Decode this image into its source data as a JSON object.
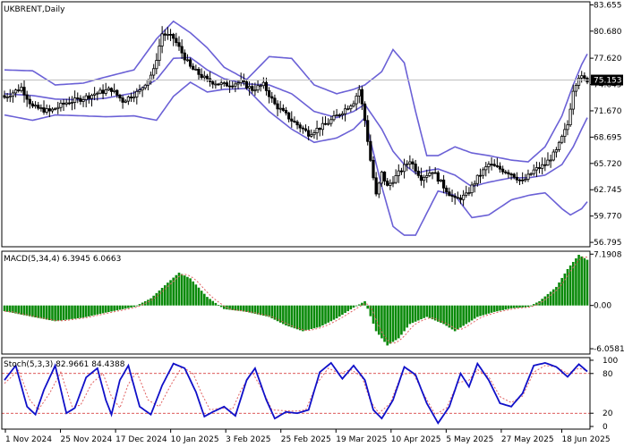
{
  "chart_data": [
    {
      "type": "candlestick",
      "title": "UKBRENT,Daily",
      "last_price_label": "75.153",
      "y_ticks": [
        "83.655",
        "80.680",
        "77.620",
        "74.645",
        "71.670",
        "68.695",
        "65.720",
        "62.745",
        "59.770",
        "56.795"
      ],
      "y_tick_values": [
        83.655,
        80.68,
        77.62,
        74.645,
        71.67,
        68.695,
        65.72,
        62.745,
        59.77,
        56.795
      ],
      "ylim": [
        56.3,
        84.0
      ],
      "x_labels": [
        "1 Nov 2024",
        "25 Nov 2024",
        "17 Dec 2024",
        "10 Jan 2025",
        "3 Feb 2025",
        "25 Feb 2025",
        "19 Mar 2025",
        "10 Apr 2025",
        "5 May 2025",
        "27 May 2025",
        "18 Jun 2025"
      ],
      "colors": {
        "up": "#000000",
        "down": "#000000",
        "bollinger": "#6b61d6",
        "last_line": "#c0c0c0"
      },
      "close_keypoints": [
        [
          0,
          73.2
        ],
        [
          6,
          74.3
        ],
        [
          10,
          72.1
        ],
        [
          16,
          71.6
        ],
        [
          22,
          72.6
        ],
        [
          28,
          73.1
        ],
        [
          32,
          73.6
        ],
        [
          38,
          74.1
        ],
        [
          42,
          72.8
        ],
        [
          48,
          73.9
        ],
        [
          53,
          76.2
        ],
        [
          56,
          80.4
        ],
        [
          60,
          79.9
        ],
        [
          66,
          76.6
        ],
        [
          72,
          75.1
        ],
        [
          78,
          74.6
        ],
        [
          84,
          74.9
        ],
        [
          88,
          74.1
        ],
        [
          92,
          74.6
        ],
        [
          96,
          72.4
        ],
        [
          102,
          70.6
        ],
        [
          108,
          69.1
        ],
        [
          114,
          70.1
        ],
        [
          120,
          71.6
        ],
        [
          124,
          72.7
        ],
        [
          126,
          74.1
        ],
        [
          128,
          70.6
        ],
        [
          130,
          66.1
        ],
        [
          132,
          62.1
        ],
        [
          134,
          64.6
        ],
        [
          136,
          63.1
        ],
        [
          140,
          64.6
        ],
        [
          144,
          66.1
        ],
        [
          148,
          64.1
        ],
        [
          152,
          64.9
        ],
        [
          156,
          63.1
        ],
        [
          160,
          61.6
        ],
        [
          164,
          62.1
        ],
        [
          168,
          64.1
        ],
        [
          172,
          65.6
        ],
        [
          176,
          65.1
        ],
        [
          180,
          64.6
        ],
        [
          184,
          63.6
        ],
        [
          188,
          64.9
        ],
        [
          192,
          65.6
        ],
        [
          196,
          67.1
        ],
        [
          200,
          70.1
        ],
        [
          202,
          74.1
        ],
        [
          204,
          75.6
        ],
        [
          206,
          75.2
        ],
        [
          207,
          75.15
        ]
      ],
      "bollinger_upper_keypoints": [
        [
          0,
          76.3
        ],
        [
          10,
          76.2
        ],
        [
          18,
          74.6
        ],
        [
          28,
          74.8
        ],
        [
          36,
          75.5
        ],
        [
          46,
          76.3
        ],
        [
          54,
          79.8
        ],
        [
          60,
          81.8
        ],
        [
          66,
          80.5
        ],
        [
          72,
          78.8
        ],
        [
          78,
          76.6
        ],
        [
          86,
          75.2
        ],
        [
          94,
          77.8
        ],
        [
          102,
          77.6
        ],
        [
          110,
          74.6
        ],
        [
          118,
          73.6
        ],
        [
          124,
          74.1
        ],
        [
          128,
          74.6
        ],
        [
          134,
          76.1
        ],
        [
          138,
          78.6
        ],
        [
          142,
          77.1
        ],
        [
          146,
          71.6
        ],
        [
          150,
          66.6
        ],
        [
          154,
          66.6
        ],
        [
          160,
          67.6
        ],
        [
          166,
          66.9
        ],
        [
          172,
          66.6
        ],
        [
          180,
          66.1
        ],
        [
          186,
          65.9
        ],
        [
          192,
          67.6
        ],
        [
          198,
          71.1
        ],
        [
          202,
          74.6
        ],
        [
          205,
          76.9
        ],
        [
          207,
          78.1
        ]
      ],
      "bollinger_middle_keypoints": [
        [
          0,
          73.6
        ],
        [
          10,
          73.4
        ],
        [
          18,
          73.0
        ],
        [
          28,
          72.9
        ],
        [
          36,
          73.1
        ],
        [
          46,
          73.7
        ],
        [
          54,
          75.2
        ],
        [
          60,
          77.6
        ],
        [
          66,
          77.7
        ],
        [
          72,
          76.3
        ],
        [
          78,
          75.3
        ],
        [
          86,
          74.7
        ],
        [
          94,
          74.6
        ],
        [
          102,
          73.6
        ],
        [
          110,
          71.6
        ],
        [
          118,
          70.9
        ],
        [
          124,
          71.6
        ],
        [
          128,
          72.4
        ],
        [
          134,
          69.6
        ],
        [
          138,
          67.1
        ],
        [
          142,
          65.6
        ],
        [
          146,
          64.6
        ],
        [
          150,
          64.9
        ],
        [
          154,
          65.1
        ],
        [
          160,
          64.4
        ],
        [
          166,
          63.1
        ],
        [
          172,
          63.6
        ],
        [
          180,
          64.1
        ],
        [
          186,
          64.1
        ],
        [
          192,
          64.4
        ],
        [
          198,
          65.6
        ],
        [
          202,
          67.6
        ],
        [
          205,
          69.6
        ],
        [
          207,
          70.9
        ]
      ],
      "bollinger_lower_keypoints": [
        [
          0,
          71.2
        ],
        [
          10,
          70.6
        ],
        [
          18,
          71.2
        ],
        [
          28,
          71.1
        ],
        [
          36,
          71.0
        ],
        [
          46,
          71.1
        ],
        [
          54,
          70.6
        ],
        [
          60,
          73.3
        ],
        [
          66,
          74.9
        ],
        [
          72,
          73.8
        ],
        [
          78,
          74.1
        ],
        [
          86,
          74.2
        ],
        [
          94,
          71.6
        ],
        [
          102,
          69.6
        ],
        [
          110,
          68.1
        ],
        [
          118,
          68.6
        ],
        [
          124,
          69.6
        ],
        [
          128,
          70.9
        ],
        [
          134,
          63.1
        ],
        [
          138,
          58.6
        ],
        [
          142,
          57.6
        ],
        [
          146,
          57.6
        ],
        [
          150,
          60.1
        ],
        [
          154,
          62.6
        ],
        [
          160,
          62.1
        ],
        [
          166,
          59.6
        ],
        [
          172,
          59.9
        ],
        [
          180,
          61.6
        ],
        [
          186,
          62.1
        ],
        [
          192,
          62.4
        ],
        [
          198,
          60.6
        ],
        [
          201,
          59.9
        ],
        [
          205,
          60.6
        ],
        [
          207,
          61.4
        ]
      ]
    },
    {
      "type": "bar",
      "title": "MACD(5,34,4) 6.3945 6.0663",
      "indicator": "MACD",
      "params": [
        5,
        34,
        4
      ],
      "current_macd": 6.3945,
      "current_signal": 6.0663,
      "y_ticks": [
        "7.1908",
        "0.00",
        "-6.0581"
      ],
      "y_tick_values": [
        7.1908,
        0,
        -6.0581
      ],
      "ylim": [
        -6.8,
        7.6
      ],
      "colors": {
        "histogram": "#0a8a0a",
        "signal": "#e06060"
      },
      "macd_keypoints": [
        [
          0,
          -0.8
        ],
        [
          10,
          -1.6
        ],
        [
          18,
          -2.2
        ],
        [
          28,
          -1.7
        ],
        [
          36,
          -1.0
        ],
        [
          46,
          -0.2
        ],
        [
          52,
          1.0
        ],
        [
          58,
          3.2
        ],
        [
          62,
          4.6
        ],
        [
          66,
          3.8
        ],
        [
          72,
          1.2
        ],
        [
          78,
          -0.5
        ],
        [
          86,
          -0.9
        ],
        [
          94,
          -1.6
        ],
        [
          100,
          -2.8
        ],
        [
          106,
          -3.6
        ],
        [
          112,
          -3.0
        ],
        [
          118,
          -1.8
        ],
        [
          124,
          -0.3
        ],
        [
          128,
          0.6
        ],
        [
          132,
          -3.6
        ],
        [
          136,
          -5.6
        ],
        [
          140,
          -4.6
        ],
        [
          144,
          -2.6
        ],
        [
          150,
          -1.6
        ],
        [
          156,
          -2.6
        ],
        [
          160,
          -3.6
        ],
        [
          164,
          -2.6
        ],
        [
          168,
          -1.6
        ],
        [
          174,
          -0.9
        ],
        [
          180,
          -0.4
        ],
        [
          186,
          -0.2
        ],
        [
          190,
          0.6
        ],
        [
          196,
          2.6
        ],
        [
          200,
          5.1
        ],
        [
          204,
          7.1
        ],
        [
          207,
          6.4
        ]
      ]
    },
    {
      "type": "line",
      "title": "Stoch(5,3,3) 82.9661 84.4388",
      "indicator": "Stochastic",
      "params": [
        5,
        3,
        3
      ],
      "current_k": 82.9661,
      "current_d": 84.4388,
      "y_ticks": [
        "100",
        "80",
        "20",
        "0"
      ],
      "y_tick_values": [
        100,
        80,
        20,
        0
      ],
      "levels": [
        80,
        20
      ],
      "ylim": [
        -4,
        104
      ],
      "colors": {
        "k_line": "#1010c8",
        "d_line": "#e06060",
        "levels": "#d02020"
      },
      "k_keypoints": [
        [
          0,
          70
        ],
        [
          4,
          92
        ],
        [
          8,
          30
        ],
        [
          11,
          18
        ],
        [
          14,
          55
        ],
        [
          18,
          92
        ],
        [
          22,
          20
        ],
        [
          25,
          28
        ],
        [
          29,
          74
        ],
        [
          33,
          88
        ],
        [
          36,
          40
        ],
        [
          38,
          18
        ],
        [
          41,
          70
        ],
        [
          44,
          92
        ],
        [
          48,
          30
        ],
        [
          52,
          18
        ],
        [
          56,
          62
        ],
        [
          60,
          95
        ],
        [
          64,
          88
        ],
        [
          68,
          52
        ],
        [
          71,
          15
        ],
        [
          74,
          22
        ],
        [
          78,
          30
        ],
        [
          82,
          16
        ],
        [
          86,
          70
        ],
        [
          89,
          88
        ],
        [
          93,
          40
        ],
        [
          96,
          12
        ],
        [
          100,
          22
        ],
        [
          104,
          20
        ],
        [
          108,
          25
        ],
        [
          112,
          82
        ],
        [
          116,
          96
        ],
        [
          120,
          72
        ],
        [
          124,
          92
        ],
        [
          128,
          70
        ],
        [
          131,
          25
        ],
        [
          134,
          12
        ],
        [
          138,
          40
        ],
        [
          142,
          90
        ],
        [
          146,
          78
        ],
        [
          150,
          35
        ],
        [
          154,
          5
        ],
        [
          158,
          30
        ],
        [
          162,
          80
        ],
        [
          165,
          60
        ],
        [
          168,
          95
        ],
        [
          172,
          70
        ],
        [
          176,
          35
        ],
        [
          180,
          30
        ],
        [
          184,
          50
        ],
        [
          188,
          92
        ],
        [
          192,
          96
        ],
        [
          196,
          90
        ],
        [
          200,
          75
        ],
        [
          204,
          94
        ],
        [
          207,
          83
        ]
      ],
      "d_keypoints": [
        [
          0,
          65
        ],
        [
          5,
          85
        ],
        [
          9,
          40
        ],
        [
          12,
          25
        ],
        [
          16,
          50
        ],
        [
          20,
          82
        ],
        [
          24,
          30
        ],
        [
          27,
          32
        ],
        [
          31,
          65
        ],
        [
          35,
          80
        ],
        [
          38,
          45
        ],
        [
          41,
          28
        ],
        [
          44,
          64
        ],
        [
          47,
          82
        ],
        [
          51,
          40
        ],
        [
          55,
          30
        ],
        [
          59,
          62
        ],
        [
          63,
          90
        ],
        [
          67,
          80
        ],
        [
          70,
          50
        ],
        [
          73,
          25
        ],
        [
          77,
          28
        ],
        [
          81,
          26
        ],
        [
          84,
          55
        ],
        [
          88,
          82
        ],
        [
          92,
          52
        ],
        [
          95,
          25
        ],
        [
          99,
          24
        ],
        [
          103,
          23
        ],
        [
          107,
          25
        ],
        [
          111,
          65
        ],
        [
          115,
          88
        ],
        [
          119,
          80
        ],
        [
          123,
          86
        ],
        [
          127,
          75
        ],
        [
          130,
          38
        ],
        [
          133,
          20
        ],
        [
          137,
          35
        ],
        [
          141,
          78
        ],
        [
          145,
          82
        ],
        [
          149,
          48
        ],
        [
          153,
          18
        ],
        [
          157,
          28
        ],
        [
          161,
          66
        ],
        [
          165,
          70
        ],
        [
          168,
          86
        ],
        [
          172,
          75
        ],
        [
          176,
          45
        ],
        [
          180,
          36
        ],
        [
          184,
          46
        ],
        [
          188,
          82
        ],
        [
          192,
          92
        ],
        [
          196,
          90
        ],
        [
          200,
          80
        ],
        [
          204,
          88
        ],
        [
          207,
          84
        ]
      ]
    }
  ]
}
